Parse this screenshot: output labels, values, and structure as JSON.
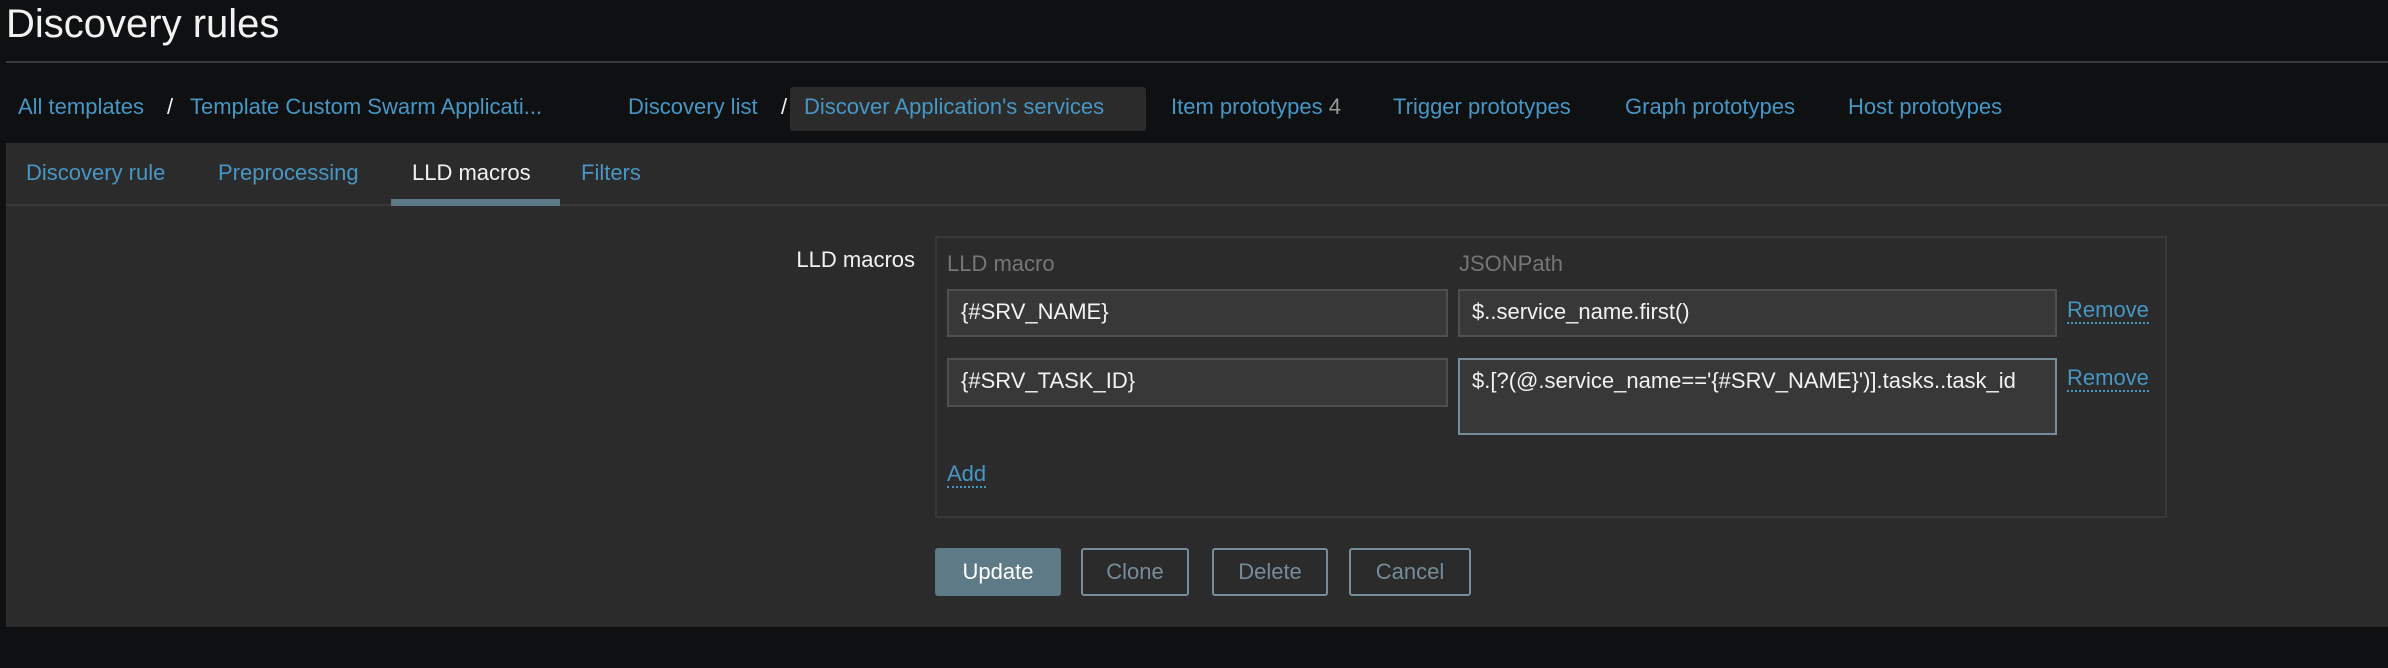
{
  "page_title": "Discovery rules",
  "breadcrumb": {
    "all_templates": "All templates",
    "separator": "/",
    "template": "Template Custom Swarm Applicati...",
    "discovery_list": "Discovery list",
    "current_rule": "Discover Application's services",
    "item_prototypes": "Item prototypes",
    "item_prototypes_count": "4",
    "trigger_prototypes": "Trigger prototypes",
    "graph_prototypes": "Graph prototypes",
    "host_prototypes": "Host prototypes"
  },
  "tabs": [
    {
      "label": "Discovery rule"
    },
    {
      "label": "Preprocessing"
    },
    {
      "label": "LLD macros",
      "active": true
    },
    {
      "label": "Filters"
    }
  ],
  "form": {
    "label": "LLD macros",
    "col_macro": "LLD macro",
    "col_path": "JSONPath",
    "rows": [
      {
        "macro": "{#SRV_NAME}",
        "path": "$..service_name.first()",
        "remove": "Remove"
      },
      {
        "macro": "{#SRV_TASK_ID}",
        "path": "$.[?(@.service_name=='{#SRV_NAME}')].tasks..task_id",
        "remove": "Remove"
      }
    ],
    "add": "Add"
  },
  "buttons": {
    "update": "Update",
    "clone": "Clone",
    "delete": "Delete",
    "cancel": "Cancel"
  },
  "colors": {
    "link": "#4796c4",
    "panel": "#2b2b2b",
    "primary": "#5e7a87"
  }
}
